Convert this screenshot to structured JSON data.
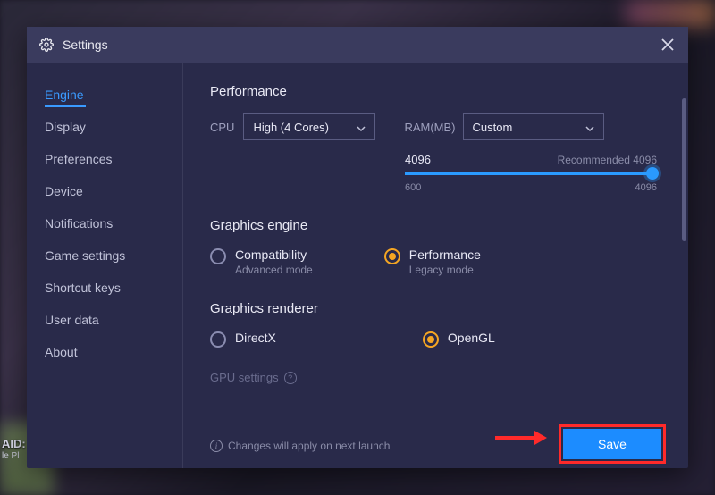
{
  "window": {
    "title": "Settings"
  },
  "sidebar": {
    "items": [
      {
        "label": "Engine",
        "active": true
      },
      {
        "label": "Display"
      },
      {
        "label": "Preferences"
      },
      {
        "label": "Device"
      },
      {
        "label": "Notifications"
      },
      {
        "label": "Game settings"
      },
      {
        "label": "Shortcut keys"
      },
      {
        "label": "User data"
      },
      {
        "label": "About"
      }
    ]
  },
  "performance": {
    "heading": "Performance",
    "cpu_label": "CPU",
    "cpu_value": "High (4 Cores)",
    "ram_label": "RAM(MB)",
    "ram_value": "Custom",
    "ram_current": "4096",
    "ram_recommended": "Recommended 4096",
    "ram_min": "600",
    "ram_max": "4096"
  },
  "graphics_engine": {
    "heading": "Graphics engine",
    "options": [
      {
        "label": "Compatibility",
        "sub": "Advanced mode",
        "checked": false
      },
      {
        "label": "Performance",
        "sub": "Legacy mode",
        "checked": true
      }
    ]
  },
  "graphics_renderer": {
    "heading": "Graphics renderer",
    "options": [
      {
        "label": "DirectX",
        "checked": false
      },
      {
        "label": "OpenGL",
        "checked": true
      }
    ]
  },
  "gpu": {
    "heading": "GPU settings"
  },
  "notice": "Changes will apply on next launch",
  "save": "Save"
}
